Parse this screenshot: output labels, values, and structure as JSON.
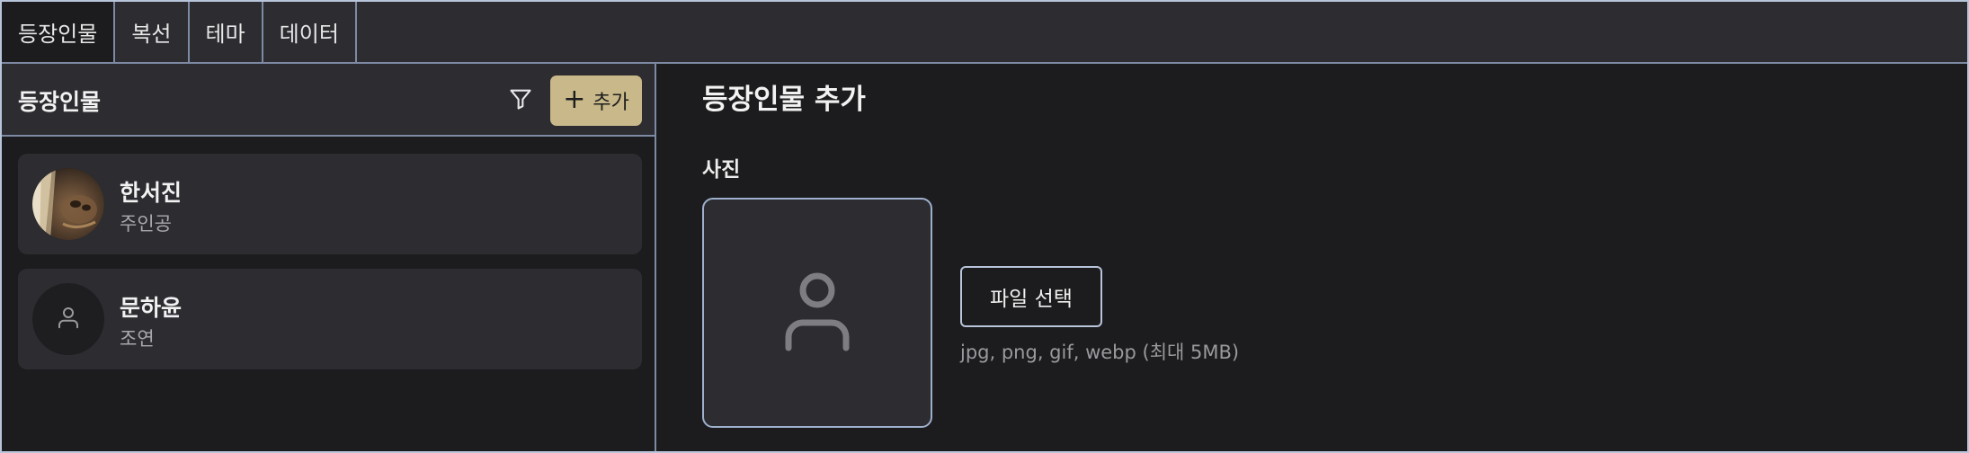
{
  "tabs": [
    {
      "label": "등장인물",
      "active": true
    },
    {
      "label": "복선",
      "active": false
    },
    {
      "label": "테마",
      "active": false
    },
    {
      "label": "데이터",
      "active": false
    }
  ],
  "sidebar": {
    "title": "등장인물",
    "filter_icon": "filter-icon",
    "add_label": "추가",
    "characters": [
      {
        "name": "한서진",
        "role": "주인공",
        "avatar": "photo"
      },
      {
        "name": "문하윤",
        "role": "조연",
        "avatar": "person-icon"
      }
    ]
  },
  "main": {
    "title": "등장인물 추가",
    "photo_label": "사진",
    "file_button": "파일 선택",
    "file_hint": "jpg, png, gif, webp (최대 5MB)"
  },
  "colors": {
    "accent": "#c9b98a",
    "panel": "#2c2c31",
    "background": "#1c1c1e",
    "border": "#7d8aa3"
  }
}
